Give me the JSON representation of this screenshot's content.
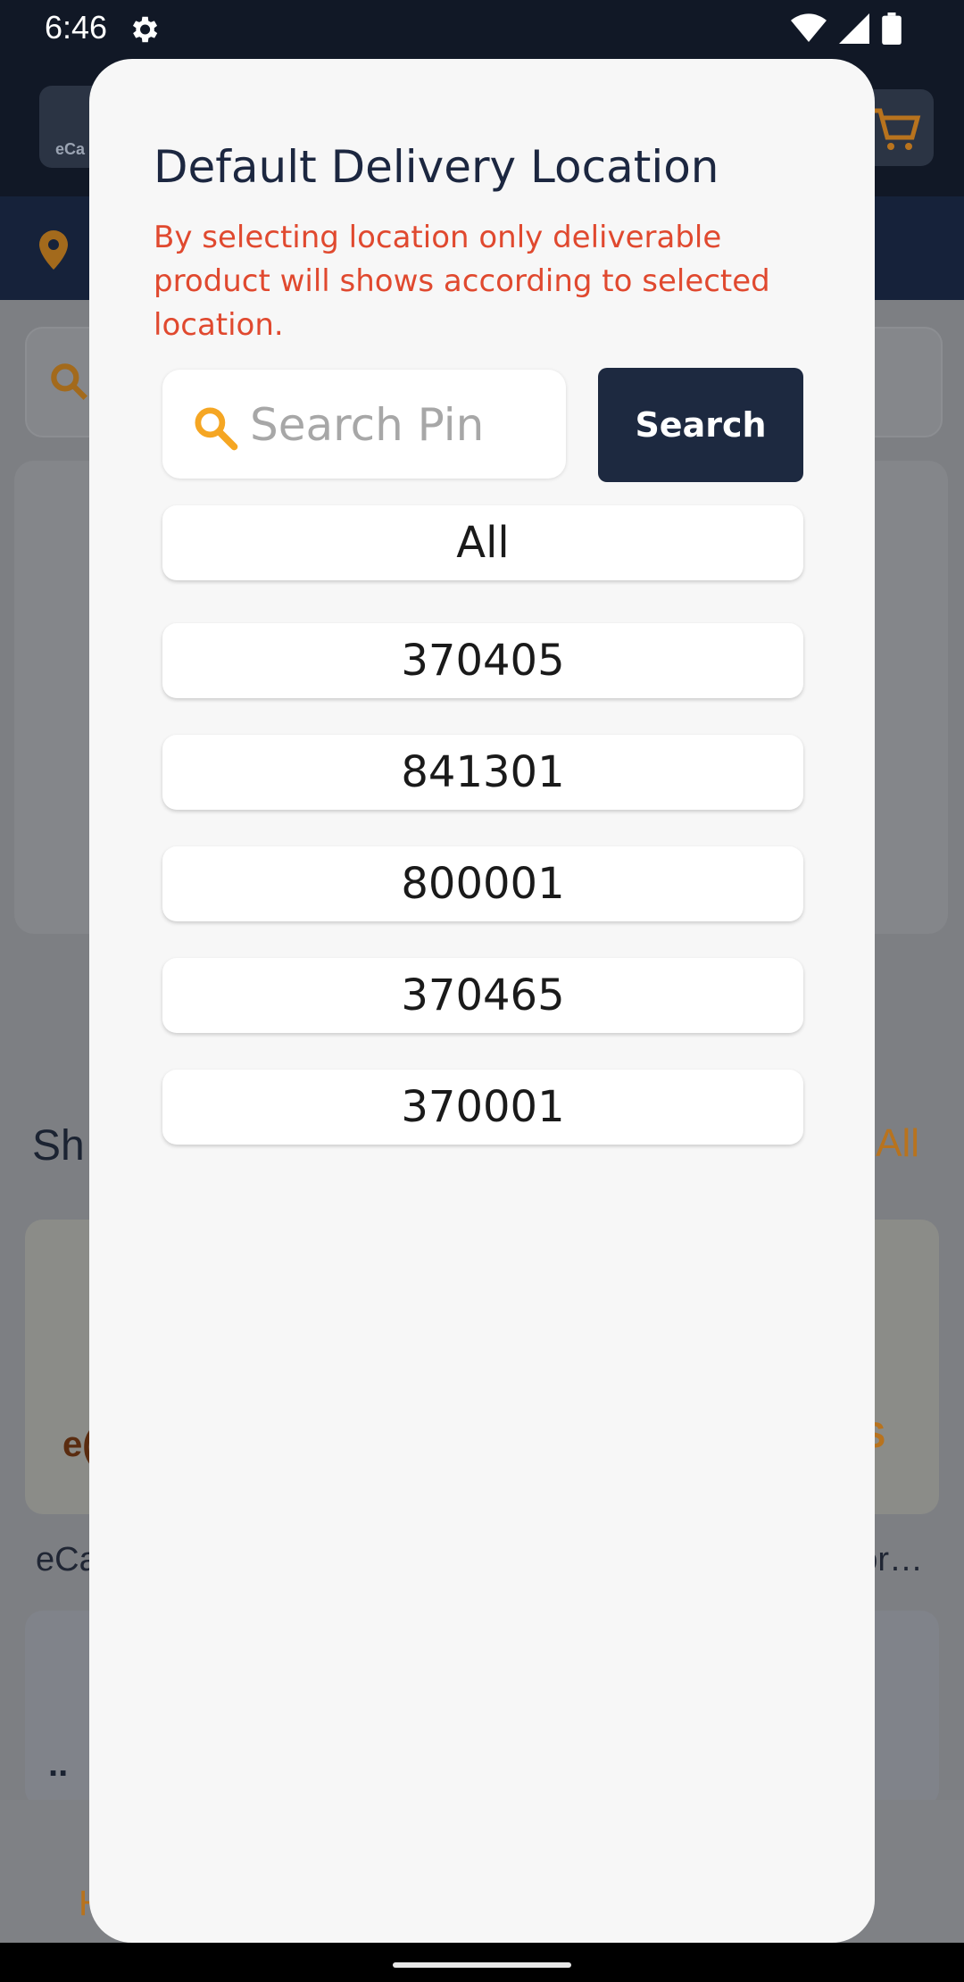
{
  "status_bar": {
    "time": "6:46"
  },
  "background": {
    "logo_text": "eCa",
    "section_title": "Sh",
    "view_all": "All",
    "card_brand_left": "e(",
    "card_brand_right": "S",
    "card_caption_left": "eCa",
    "card_caption_right": "or…",
    "card2_text": "..",
    "nav_home_label": "H"
  },
  "dialog": {
    "title": "Default Delivery Location",
    "note": "By selecting location only deliverable product will shows according to selected location.",
    "search": {
      "placeholder": "Search Pin",
      "value": "",
      "button_label": "Search"
    },
    "pins": [
      "All",
      "370405",
      "841301",
      "800001",
      "370465",
      "370001"
    ]
  },
  "colors": {
    "accent": "#f5a623",
    "dark_navy": "#1d2940",
    "note_red": "#e0492f"
  }
}
